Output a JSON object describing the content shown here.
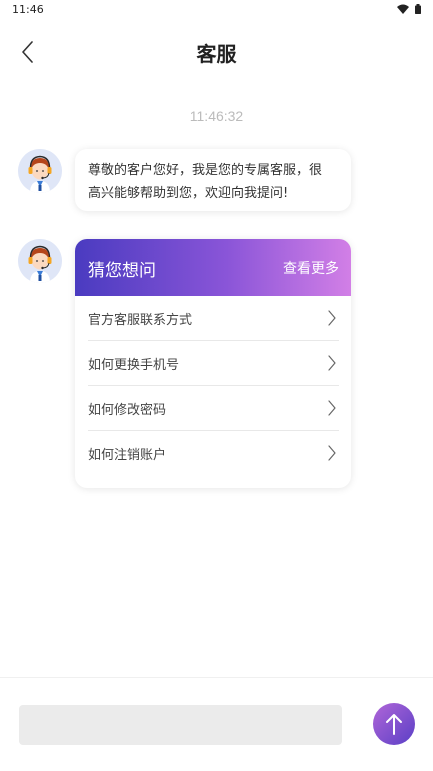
{
  "status_bar": {
    "time": "11:46",
    "icons": [
      "wifi-icon",
      "battery-icon"
    ]
  },
  "nav": {
    "title": "客服",
    "back_icon": "chevron-left-icon"
  },
  "chat": {
    "timestamp": "11:46:32",
    "welcome_message": {
      "line1": "尊敬的客户您好，我是您的专属客服，很",
      "line2": "高兴能够帮助到您，欢迎向我提问!"
    },
    "faq_card": {
      "title": "猜您想问",
      "more_label": "查看更多",
      "items": [
        {
          "label": "官方客服联系方式"
        },
        {
          "label": "如何更换手机号"
        },
        {
          "label": "如何修改密码"
        },
        {
          "label": "如何注销账户"
        }
      ]
    }
  },
  "composer": {
    "input_value": "",
    "placeholder": "",
    "send_icon": "arrow-up-icon"
  },
  "colors": {
    "accent_gradient_start": "#4a3bc0",
    "accent_gradient_end": "#d27fe6",
    "send_button": "#7a4fd0",
    "timestamp": "#bbbbbb",
    "input_bg": "#ebebeb"
  }
}
